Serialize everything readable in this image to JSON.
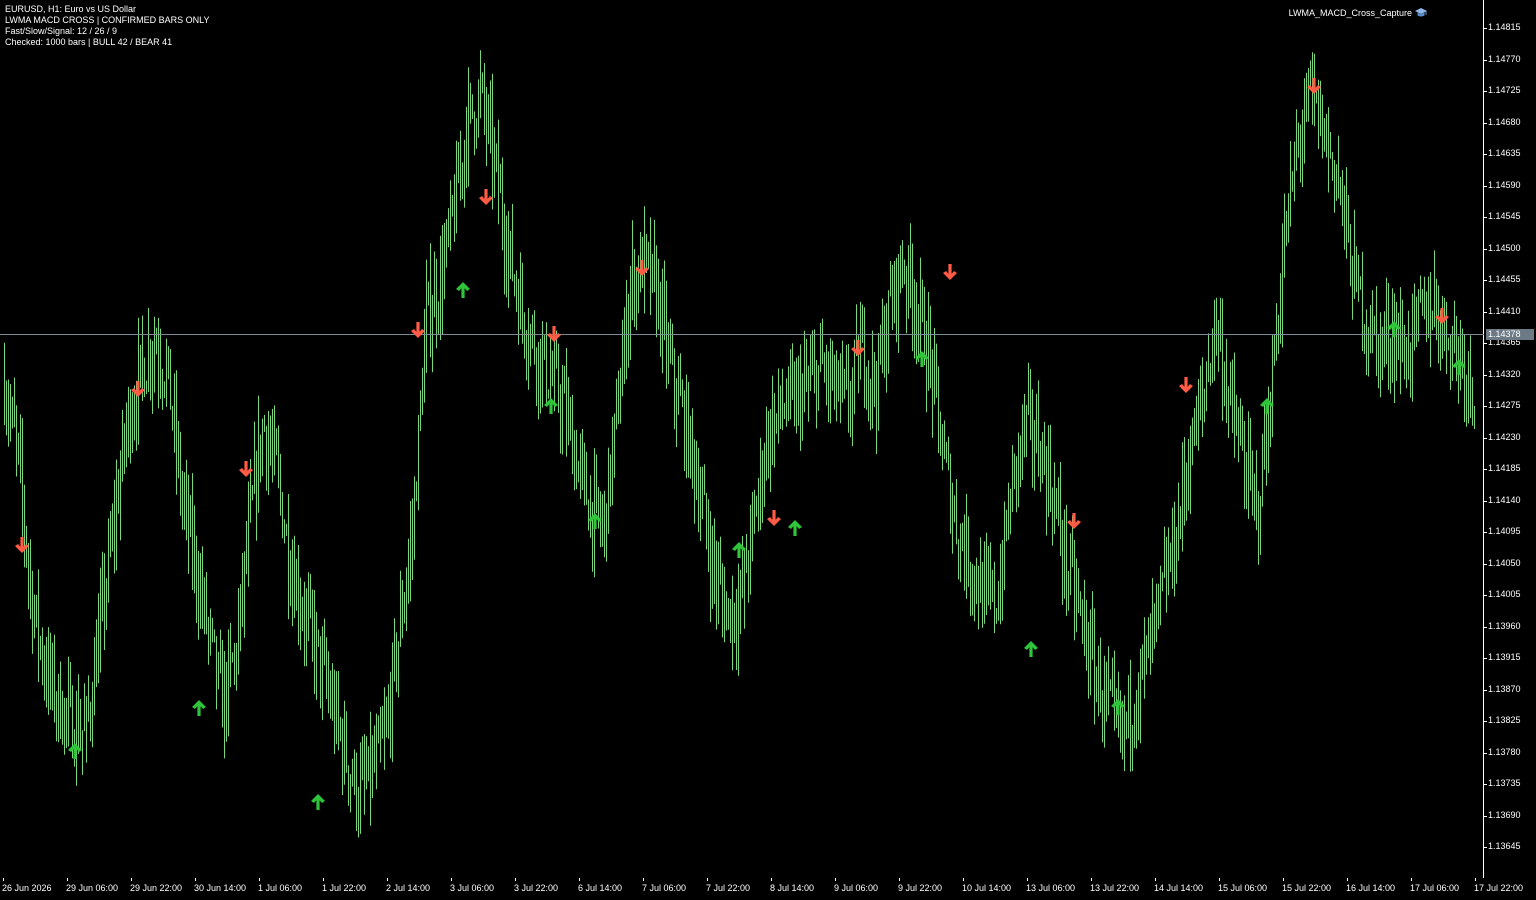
{
  "header": {
    "line1": "EURUSD, H1:  Euro vs US Dollar",
    "line2": "LWMA MACD CROSS | CONFIRMED BARS ONLY",
    "line3": "Fast/Slow/Signal: 12 / 26 / 9",
    "line4": "Checked: 1000 bars | BULL 42 / BEAR 41"
  },
  "expert": {
    "name": "LWMA_MACD_Cross_Capture",
    "icon": "graduation-cap-icon"
  },
  "colors": {
    "background": "#000000",
    "candles": "#7ad67a",
    "bull_arrow": "#2fc43a",
    "bear_arrow": "#ff5b45",
    "current_price_line": "#7c8a96",
    "axis_text": "#ffffff"
  },
  "current_price": "1.14378",
  "price_axis": {
    "ticks": [
      "1.14815",
      "1.14770",
      "1.14725",
      "1.14680",
      "1.14635",
      "1.14590",
      "1.14545",
      "1.14500",
      "1.14455",
      "1.14410",
      "1.14365",
      "1.14320",
      "1.14275",
      "1.14230",
      "1.14185",
      "1.14140",
      "1.14095",
      "1.14050",
      "1.14005",
      "1.13960",
      "1.13915",
      "1.13870",
      "1.13825",
      "1.13780",
      "1.13735",
      "1.13690",
      "1.13645"
    ]
  },
  "time_axis": {
    "ticks": [
      "26 Jun 2026",
      "29 Jun 06:00",
      "29 Jun 22:00",
      "30 Jun 14:00",
      "1 Jul 06:00",
      "1 Jul 22:00",
      "2 Jul 14:00",
      "3 Jul 06:00",
      "3 Jul 22:00",
      "6 Jul 14:00",
      "7 Jul 06:00",
      "7 Jul 22:00",
      "8 Jul 14:00",
      "9 Jul 06:00",
      "9 Jul 22:00",
      "10 Jul 14:00",
      "13 Jul 06:00",
      "13 Jul 22:00",
      "14 Jul 14:00",
      "15 Jul 06:00",
      "15 Jul 22:00",
      "16 Jul 14:00",
      "17 Jul 06:00",
      "17 Jul 22:00"
    ]
  },
  "chart_data": {
    "type": "line",
    "symbol": "EURUSD",
    "timeframe": "H1",
    "ylim": [
      1.1362,
      1.1483
    ],
    "price_anchors": [
      1.1431,
      1.142,
      1.14,
      1.139,
      1.1385,
      1.1382,
      1.1381,
      1.1395,
      1.141,
      1.1425,
      1.1432,
      1.1437,
      1.1432,
      1.1415,
      1.1405,
      1.1395,
      1.1385,
      1.1392,
      1.141,
      1.1425,
      1.1418,
      1.1405,
      1.1398,
      1.1392,
      1.1385,
      1.1378,
      1.1372,
      1.1375,
      1.138,
      1.1395,
      1.141,
      1.144,
      1.1445,
      1.1455,
      1.1468,
      1.1472,
      1.1462,
      1.145,
      1.1441,
      1.1436,
      1.1432,
      1.1428,
      1.142,
      1.1413,
      1.141,
      1.1426,
      1.1445,
      1.1448,
      1.1443,
      1.1432,
      1.1425,
      1.1416,
      1.1405,
      1.1398,
      1.1399,
      1.141,
      1.1423,
      1.1427,
      1.1428,
      1.143,
      1.1433,
      1.143,
      1.1428,
      1.1436,
      1.143,
      1.1441,
      1.1448,
      1.1442,
      1.1434,
      1.142,
      1.141,
      1.1405,
      1.14,
      1.14,
      1.1416,
      1.1425,
      1.1422,
      1.1415,
      1.1405,
      1.1398,
      1.139,
      1.1385,
      1.138,
      1.1386,
      1.1392,
      1.14,
      1.1408,
      1.142,
      1.1428,
      1.144,
      1.1428,
      1.142,
      1.1412,
      1.1428,
      1.145,
      1.1465,
      1.1472,
      1.1466,
      1.146,
      1.1447,
      1.144,
      1.1436,
      1.1438,
      1.1435,
      1.144,
      1.1442,
      1.1438,
      1.1435,
      1.143
    ]
  }
}
